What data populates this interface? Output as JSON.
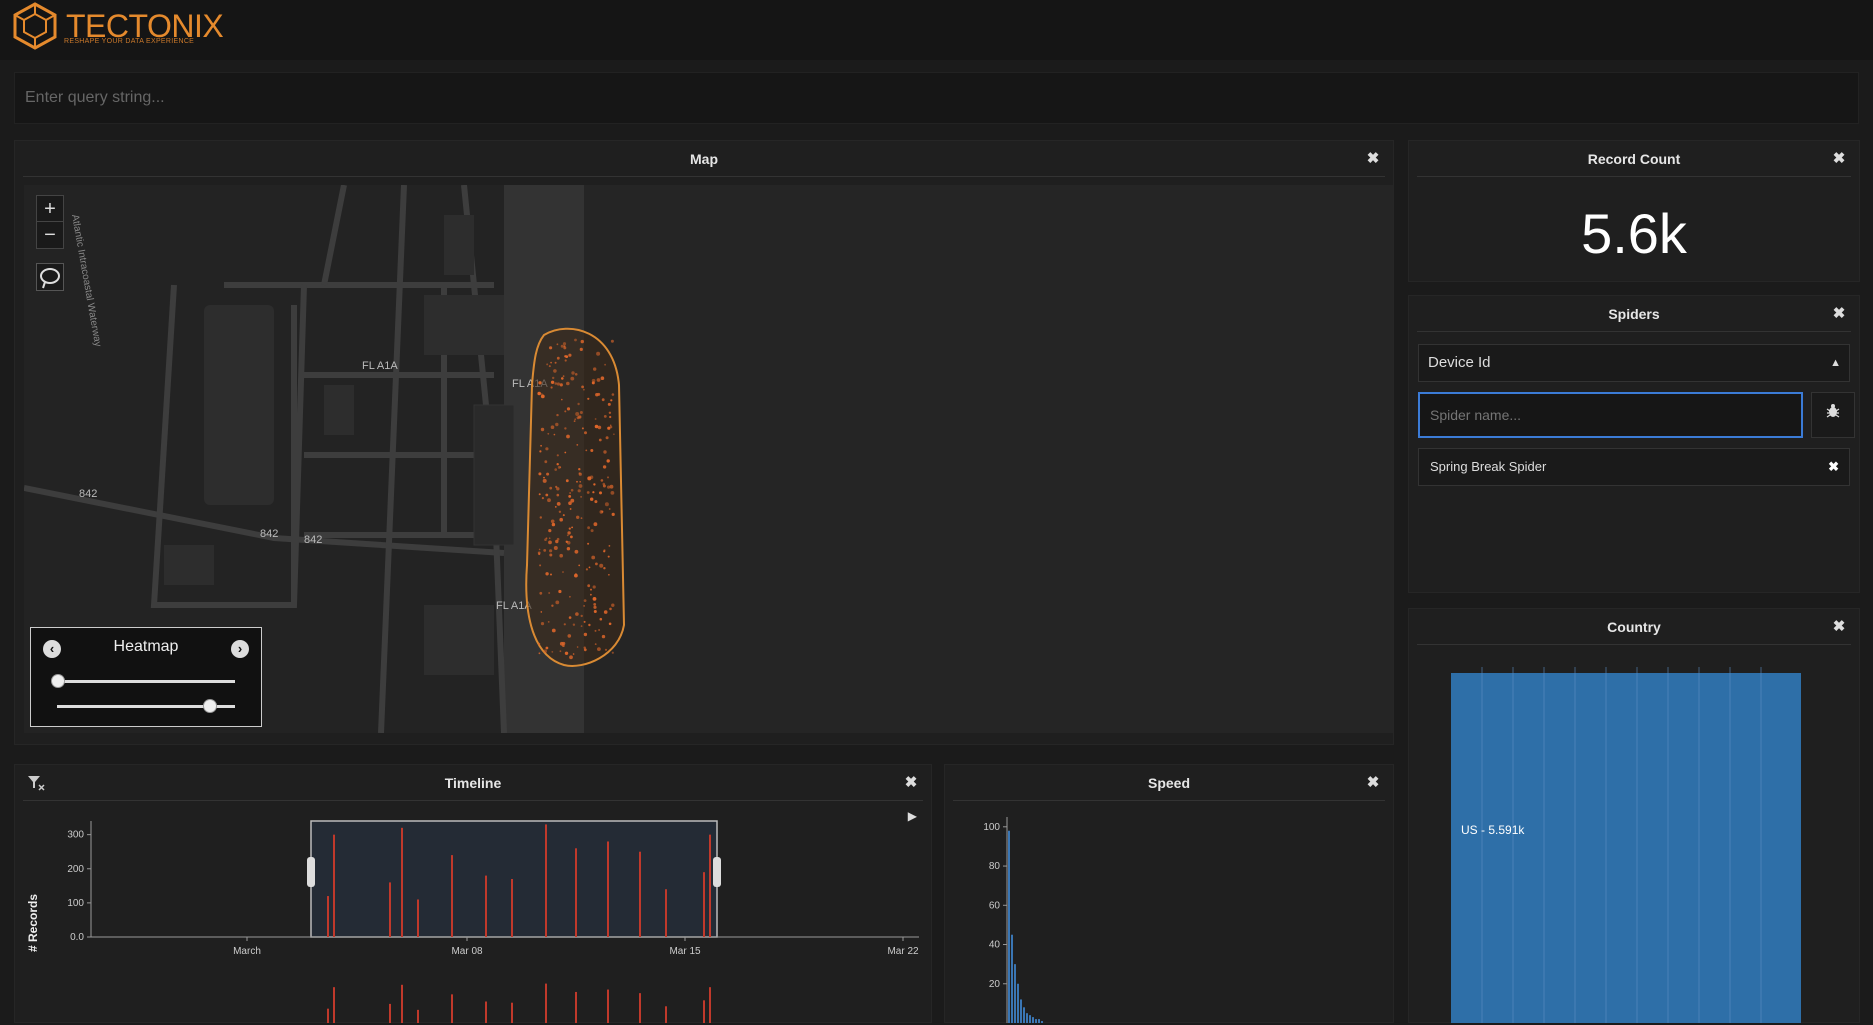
{
  "brand": {
    "name": "TECTONIX",
    "tagline": "RESHAPE YOUR DATA EXPERIENCE",
    "accent": "#e58a2d"
  },
  "query": {
    "placeholder": "Enter query string..."
  },
  "map_panel": {
    "title": "Map",
    "zoom_in": "+",
    "zoom_out": "−",
    "road_labels": [
      "FL A1A",
      "FL A1A",
      "FL A1A",
      "842",
      "842",
      "842",
      "Atlantic Intracoastal Waterway"
    ],
    "layer_control": {
      "label": "Heatmap",
      "slider1_value": 0,
      "slider2_value": 0.85
    }
  },
  "record_count": {
    "title": "Record Count",
    "value": "5.6k"
  },
  "spiders": {
    "title": "Spiders",
    "select_value": "Device Id",
    "input_placeholder": "Spider name...",
    "items": [
      "Spring Break Spider"
    ]
  },
  "country": {
    "title": "Country",
    "bar_label": "US - 5.591k",
    "bar_color": "#2e6fa8"
  },
  "timeline": {
    "title": "Timeline",
    "ylabel": "# Records"
  },
  "speed": {
    "title": "Speed"
  },
  "chart_data": [
    {
      "type": "bar",
      "title": "Timeline",
      "ylabel": "# Records",
      "yticks": [
        "0.0",
        "100",
        "200",
        "300"
      ],
      "xticks": [
        "March",
        "Mar 08",
        "Mar 15",
        "Mar 22"
      ],
      "ylim": [
        0,
        340
      ],
      "x": [
        "Mar 05",
        "Mar 06",
        "Mar 06",
        "Mar 07",
        "Mar 08",
        "Mar 09",
        "Mar 09",
        "Mar 10",
        "Mar 11",
        "Mar 12",
        "Mar 13",
        "Mar 14",
        "Mar 15",
        "Mar 16",
        "Mar 17"
      ],
      "values": [
        120,
        300,
        160,
        320,
        110,
        240,
        180,
        170,
        330,
        260,
        280,
        250,
        140,
        190,
        300
      ],
      "color": "#c0392b"
    },
    {
      "type": "bar",
      "title": "Speed",
      "yticks": [
        "20",
        "40",
        "60",
        "80",
        "100"
      ],
      "ylim": [
        0,
        105
      ],
      "values": [
        98,
        45,
        30,
        20,
        12,
        8,
        5,
        4,
        3,
        2,
        2,
        1
      ],
      "color": "#3a76b4"
    }
  ]
}
